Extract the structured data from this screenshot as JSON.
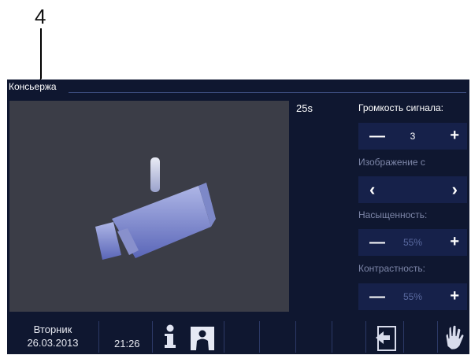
{
  "callout": {
    "number": "4"
  },
  "screen": {
    "title": "Консьержа",
    "timer": "25s",
    "video": {
      "icon": "camera-icon"
    },
    "controls": {
      "volume": {
        "label": "Громкость сигнала:",
        "value": "3"
      },
      "image": {
        "label": "Изображение с"
      },
      "saturation": {
        "label": "Насыщенность:",
        "value": "55%"
      },
      "contrast": {
        "label": "Контрастность:",
        "value": "55%"
      }
    },
    "statusbar": {
      "day": "Вторник",
      "date": "26.03.2013",
      "time": "21:26",
      "buttons": [
        "info-icon",
        "person-icon",
        "exit-icon",
        "hand-icon"
      ]
    }
  },
  "colors": {
    "background": "#0f1730",
    "video": "#3b3d47",
    "control": "#16214a"
  }
}
